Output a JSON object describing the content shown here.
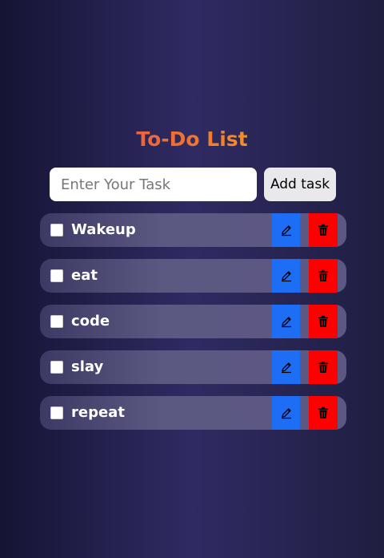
{
  "app": {
    "title": "To-Do List"
  },
  "input": {
    "placeholder": "Enter Your Task",
    "value": ""
  },
  "add_button": {
    "label": "Add task"
  },
  "tasks": [
    {
      "label": "Wakeup",
      "checked": false
    },
    {
      "label": "eat",
      "checked": false
    },
    {
      "label": "code",
      "checked": false
    },
    {
      "label": "slay",
      "checked": false
    },
    {
      "label": "repeat",
      "checked": false
    }
  ],
  "icons": {
    "edit": "pencil-icon",
    "delete": "trash-icon"
  },
  "colors": {
    "edit_button": "#1d6ef5",
    "delete_button": "#ff0000",
    "title_gradient_start": "#e8356b",
    "title_gradient_end": "#f6d12a"
  }
}
